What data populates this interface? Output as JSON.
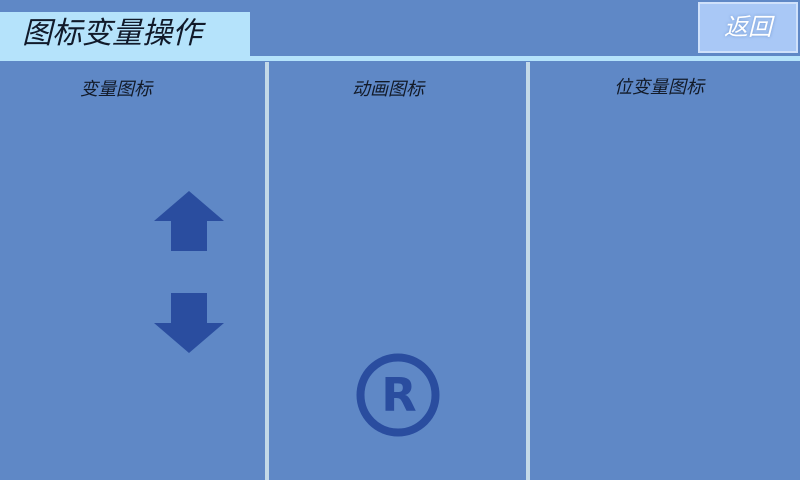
{
  "header": {
    "title": "图标变量操作",
    "back_label": "返回"
  },
  "panels": [
    {
      "title": "变量图标"
    },
    {
      "title": "动画图标"
    },
    {
      "title": "位变量图标"
    }
  ],
  "icons": {
    "up_arrow": "arrow-up-icon",
    "down_arrow": "arrow-down-icon",
    "animation": "registered-trademark-icon",
    "icon_color": "#2a4d9f"
  },
  "colors": {
    "background": "#5f88c6",
    "title_tab": "#b5e3fb",
    "back_button": "#a9c8f6",
    "divider": "#c3d9e8"
  }
}
